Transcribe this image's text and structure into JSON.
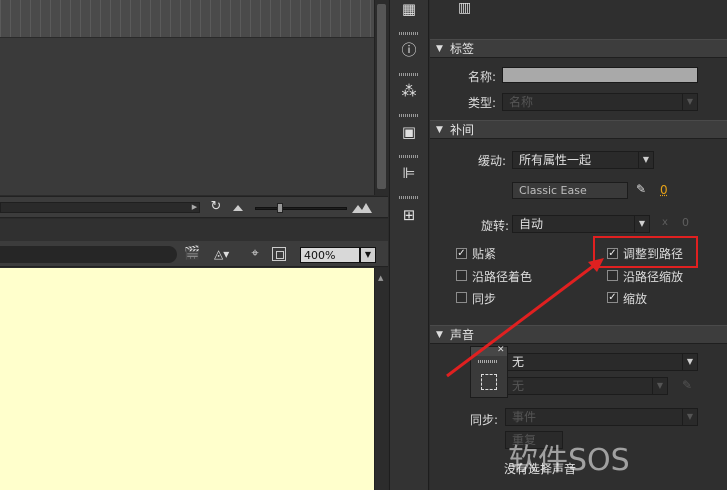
{
  "stage_toolbar": {
    "zoom_value": "400%"
  },
  "properties": {
    "label_section": {
      "title": "标签",
      "name_label": "名称:",
      "type_label": "类型:",
      "type_value": "名称"
    },
    "tween_section": {
      "title": "补间",
      "ease_label": "缓动:",
      "ease_value": "所有属性一起",
      "ease_preset": "Classic Ease",
      "ease_amount": "0",
      "rotate_label": "旋转:",
      "rotate_value": "自动",
      "rotate_x": "x",
      "rotate_count": "0",
      "checkboxes": [
        {
          "label": "贴紧",
          "checked": true
        },
        {
          "label": "调整到路径",
          "checked": true
        },
        {
          "label": "沿路径着色",
          "checked": false
        },
        {
          "label": "沿路径缩放",
          "checked": false
        },
        {
          "label": "同步",
          "checked": false
        },
        {
          "label": "缩放",
          "checked": true
        }
      ]
    },
    "sound_section": {
      "title": "声音",
      "name_value": "无",
      "effect_value": "无",
      "sync_label": "同步:",
      "sync_value": "事件",
      "repeat_value": "重复",
      "status_text": "没有选择声音"
    }
  },
  "watermark": "软件SOS",
  "colors": {
    "stage": "#ffffcc",
    "highlight": "#e02020"
  }
}
